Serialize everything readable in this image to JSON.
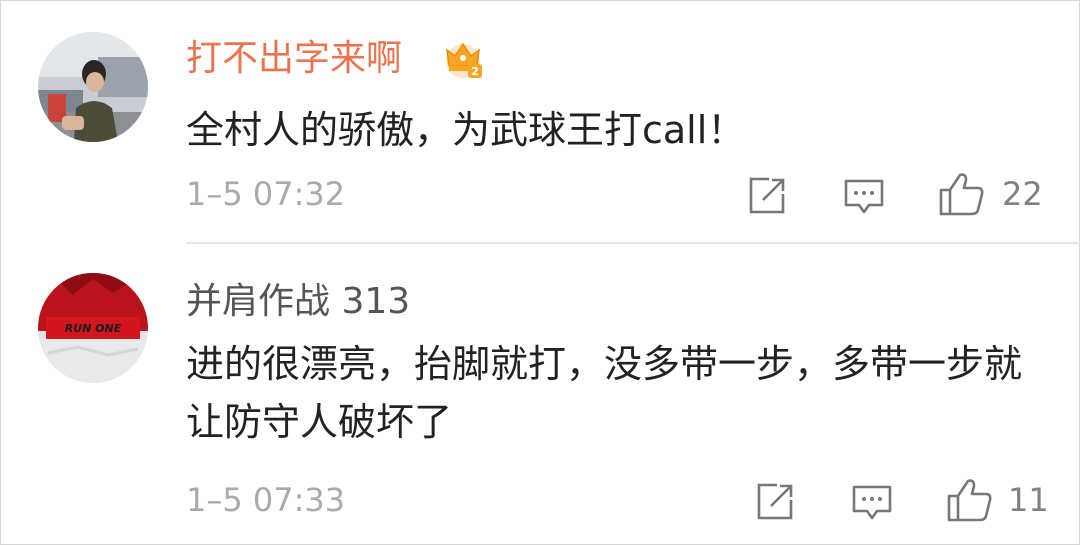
{
  "comments": [
    {
      "username": "打不出字来啊",
      "vip_icon": "crown-badge-icon",
      "text": "全村人的骄傲，为武球王打call！",
      "time": "1–5 07:32",
      "likes": "22",
      "colors": {
        "username": "#eb7350",
        "badge": "#f5a623"
      }
    },
    {
      "username": "并肩作战 313",
      "text": "进的很漂亮，抬脚就打，没多带一步，多带一步就让防守人破坏了",
      "time": "1–5 07:33",
      "likes": "11",
      "avatar_banner": "RUN ONE",
      "colors": {
        "username": "#555555",
        "avatar_bg": "#b9131b"
      }
    }
  ],
  "actions": {
    "share_icon": "share-icon",
    "reply_icon": "comment-icon",
    "like_icon": "thumbs-up-icon"
  }
}
